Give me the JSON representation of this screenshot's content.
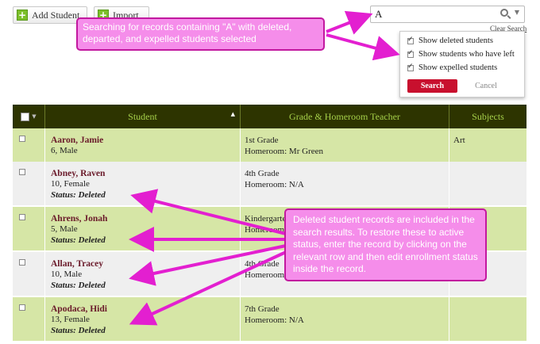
{
  "toolbar": {
    "add_student_label": "Add Student",
    "import_label": "Import"
  },
  "search": {
    "value": "A",
    "clear_label": "Clear Search"
  },
  "filter": {
    "options": [
      {
        "label": "Show deleted students",
        "checked": true
      },
      {
        "label": "Show students who have left",
        "checked": true
      },
      {
        "label": "Show expelled students",
        "checked": true
      }
    ],
    "search_label": "Search",
    "cancel_label": "Cancel"
  },
  "table": {
    "headers": {
      "student": "Student",
      "grade": "Grade & Homeroom Teacher",
      "subjects": "Subjects"
    },
    "rows": [
      {
        "name": "Aaron, Jamie",
        "info": "6, Male",
        "status": "",
        "grade": "1st Grade",
        "homeroom": "Homeroom: Mr Green",
        "subjects": "Art"
      },
      {
        "name": "Abney, Raven",
        "info": "10, Female",
        "status": "Status: Deleted",
        "grade": "4th Grade",
        "homeroom": "Homeroom: N/A",
        "subjects": ""
      },
      {
        "name": "Ahrens, Jonah",
        "info": "5, Male",
        "status": "Status: Deleted",
        "grade": "Kindergarten",
        "homeroom": "Homeroom: N/A",
        "subjects": ""
      },
      {
        "name": "Allan, Tracey",
        "info": "10, Male",
        "status": "Status: Deleted",
        "grade": "4th Grade",
        "homeroom": "Homeroom: N/A",
        "subjects": ""
      },
      {
        "name": "Apodaca, Hidi",
        "info": "13, Female",
        "status": "Status: Deleted",
        "grade": "7th Grade",
        "homeroom": "Homeroom: N/A",
        "subjects": ""
      }
    ]
  },
  "annotations": {
    "search_note": "Searching for records containing \"A\" with deleted, departed, and expelled students selected",
    "deleted_note": "Deleted student records are included in the search results. To restore these to active status, enter the record by clicking on the relevant row and then edit enrollment status inside the record."
  },
  "colors": {
    "header_bg": "#2d3400",
    "header_text": "#a6d04a",
    "row_green": "#d6e6a6",
    "row_gray": "#efefef",
    "name_text": "#6a1a2a",
    "search_button": "#c8102e",
    "callout_fill": "#f58dea",
    "callout_border": "#c2189f"
  },
  "icons": {
    "add": "plus-icon",
    "import": "plus-icon",
    "search": "magnifier-icon",
    "sort": "triangle-up-icon"
  }
}
